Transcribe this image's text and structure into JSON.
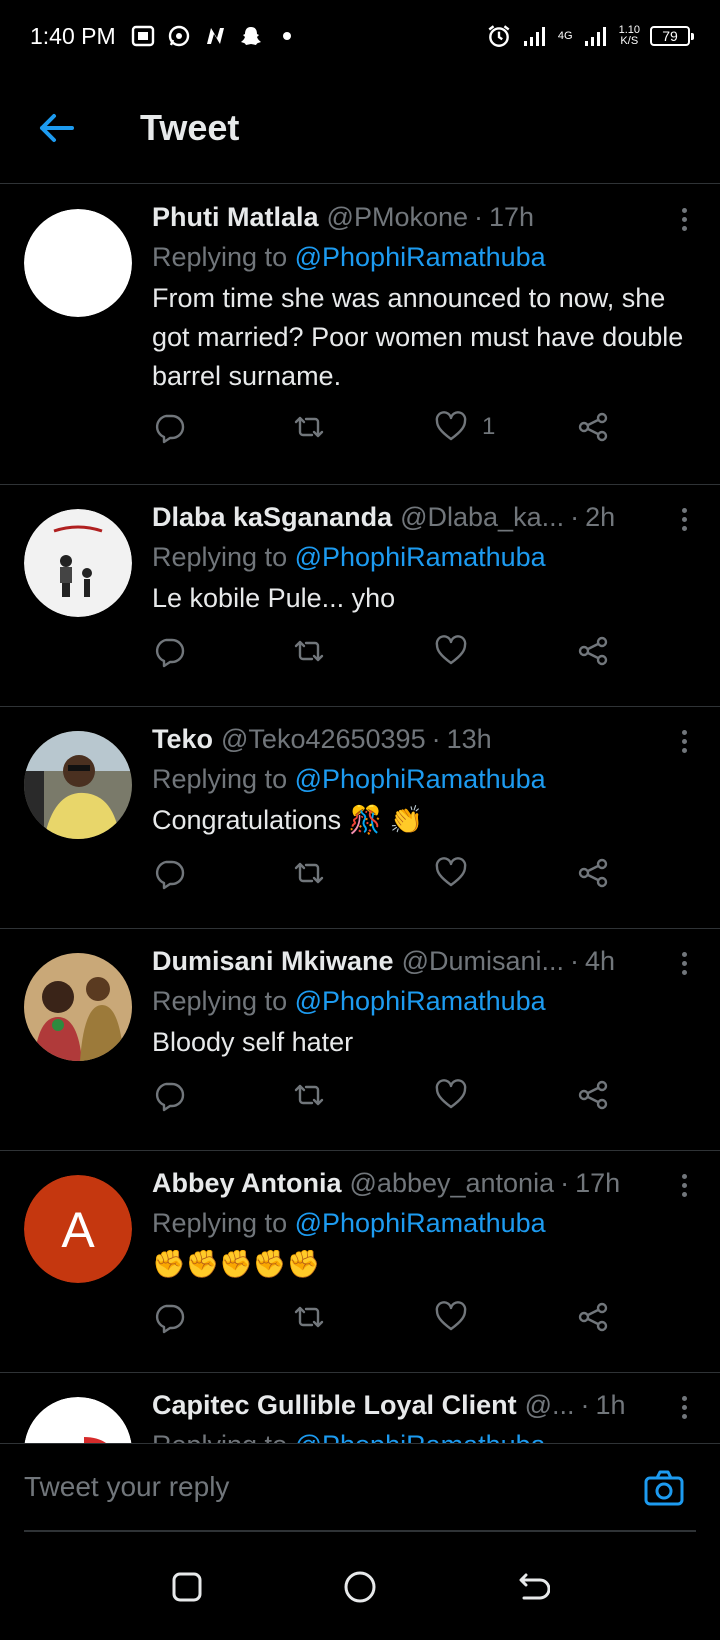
{
  "status_bar": {
    "time": "1:40 PM",
    "left_icons": [
      "gallery-icon",
      "whatsapp-icon",
      "n-app-icon",
      "snapchat-icon",
      "notification-dot-icon"
    ],
    "network_type": "4G",
    "speed_value": "1.10",
    "speed_unit": "K/S",
    "battery": "79"
  },
  "header": {
    "title": "Tweet",
    "back_icon": "back-arrow-icon",
    "accent_color": "#1d9bf0"
  },
  "tweets": [
    {
      "name": "Phuti Matlala",
      "handle": "@PMokone",
      "time": "17h",
      "replying_prefix": "Replying to",
      "replying_to": "@PhophiRamathuba",
      "text": "From time she was announced to now, she got married? Poor women must have double barrel surname.",
      "likes": "1",
      "avatar": "white-circle-avatar"
    },
    {
      "name": "Dlaba kaSgananda",
      "handle": "@Dlaba_ka...",
      "time": "2h",
      "replying_prefix": "Replying to",
      "replying_to": "@PhophiRamathuba",
      "text": "Le kobile Pule... yho",
      "likes": "",
      "avatar": "fathers-day-avatar"
    },
    {
      "name": "Teko",
      "handle": "@Teko42650395",
      "time": "13h",
      "replying_prefix": "Replying to",
      "replying_to": "@PhophiRamathuba",
      "text": "Congratulations 🎊 👏",
      "likes": "",
      "avatar": "man-in-car-avatar"
    },
    {
      "name": "Dumisani Mkiwane",
      "handle": "@Dumisani...",
      "time": "4h",
      "replying_prefix": "Replying to",
      "replying_to": "@PhophiRamathuba",
      "text": "Bloody self hater",
      "likes": "",
      "avatar": "people-photo-avatar"
    },
    {
      "name": "Abbey Antonia",
      "handle": "@abbey_antonia",
      "time": "17h",
      "replying_prefix": "Replying to",
      "replying_to": "@PhophiRamathuba",
      "text": "✊✊✊✊✊",
      "likes": "",
      "avatar": "letter-a-avatar",
      "avatar_letter": "A",
      "avatar_color": "#c5370f"
    },
    {
      "name": "Capitec Gullible Loyal Client",
      "handle": "@...",
      "time": "1h",
      "replying_prefix": "Replying to",
      "replying_to": "@PhophiRamathuba",
      "text": "",
      "likes": "",
      "avatar": "capitec-logo-avatar"
    }
  ],
  "composer": {
    "placeholder": "Tweet your reply",
    "camera_icon": "camera-icon"
  },
  "nav_bar": {
    "buttons": [
      "recents-button",
      "home-button",
      "back-button"
    ]
  }
}
